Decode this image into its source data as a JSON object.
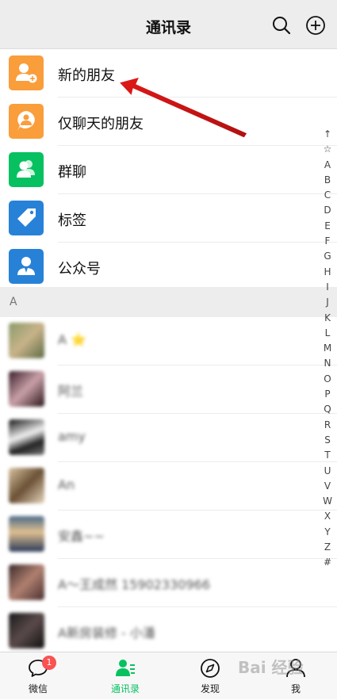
{
  "header": {
    "title": "通讯录",
    "search_icon": "search-icon",
    "add_icon": "plus-circle-icon"
  },
  "functions": [
    {
      "label": "新的朋友",
      "icon": "add-friend-icon",
      "color": "#fa9d3b"
    },
    {
      "label": "仅聊天的朋友",
      "icon": "chat-only-icon",
      "color": "#fa9d3b"
    },
    {
      "label": "群聊",
      "icon": "group-chat-icon",
      "color": "#07c160"
    },
    {
      "label": "标签",
      "icon": "tag-icon",
      "color": "#2782d7"
    },
    {
      "label": "公众号",
      "icon": "official-account-icon",
      "color": "#2782d7"
    }
  ],
  "section": {
    "letter": "A"
  },
  "contacts": [
    {
      "name": "A ⭐"
    },
    {
      "name": "阿兰"
    },
    {
      "name": "amy"
    },
    {
      "name": "An"
    },
    {
      "name": "安鑫~~"
    },
    {
      "name": "A～王成然  15902330966"
    },
    {
      "name": "A新房装修 - 小潘"
    }
  ],
  "index": [
    "↑",
    "☆",
    "A",
    "B",
    "C",
    "D",
    "E",
    "F",
    "G",
    "H",
    "I",
    "J",
    "K",
    "L",
    "M",
    "N",
    "O",
    "P",
    "Q",
    "R",
    "S",
    "T",
    "U",
    "V",
    "W",
    "X",
    "Y",
    "Z",
    "#"
  ],
  "tabs": [
    {
      "label": "微信",
      "icon": "chat-bubble-icon",
      "badge": "1"
    },
    {
      "label": "通讯录",
      "icon": "contacts-icon"
    },
    {
      "label": "发现",
      "icon": "compass-icon"
    },
    {
      "label": "我",
      "icon": "profile-icon"
    }
  ],
  "watermark": "Bai 经验",
  "colors": {
    "accent": "#07c160",
    "orange": "#fa9d3b",
    "blue": "#2782d7",
    "arrow": "#e02020",
    "badge": "#fa5151"
  }
}
